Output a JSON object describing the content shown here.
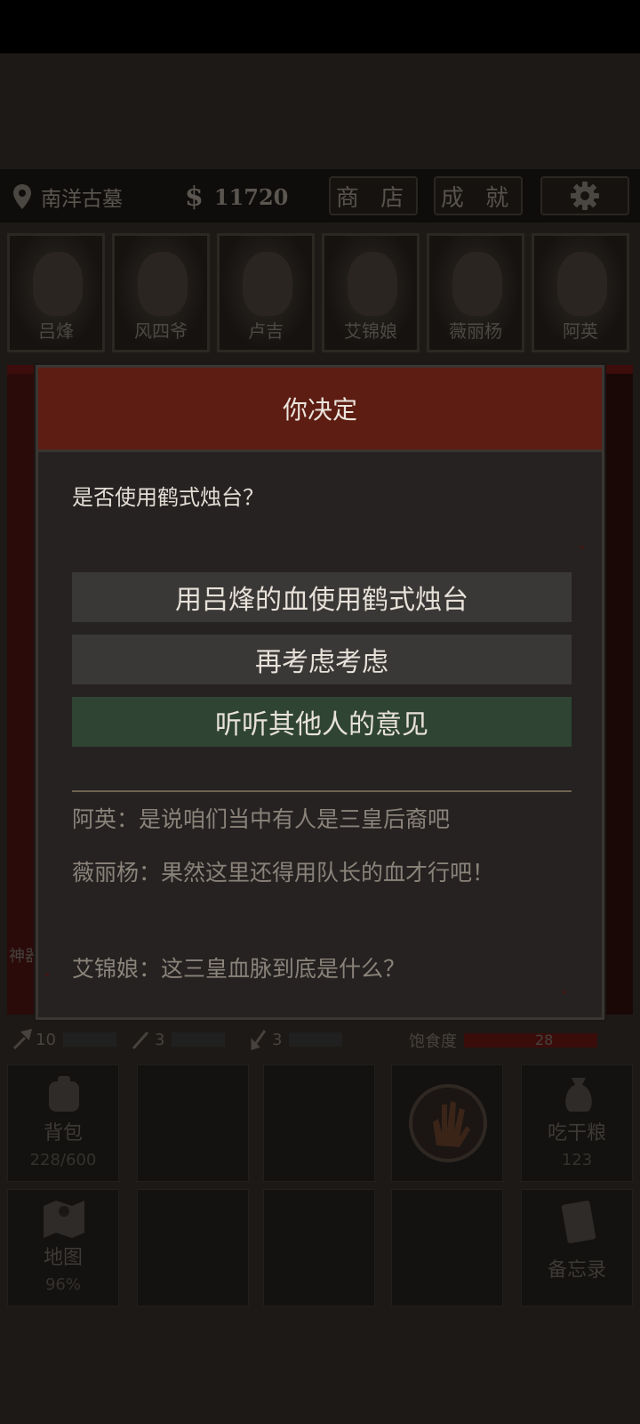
{
  "hud": {
    "location": "南洋古墓",
    "money_symbol": "$",
    "money": "11720",
    "shop_label": "商 店",
    "achievements_label": "成 就"
  },
  "characters": [
    {
      "name": "吕烽"
    },
    {
      "name": "风四爷"
    },
    {
      "name": "卢吉"
    },
    {
      "name": "艾锦娘"
    },
    {
      "name": "薇丽杨"
    },
    {
      "name": "阿英"
    }
  ],
  "side_label": "神器",
  "stats": {
    "stat1": "10",
    "stat2": "3",
    "stat3": "3",
    "satiety_label": "饱食度",
    "satiety_value": "28"
  },
  "actions": {
    "backpack_label": "背包",
    "backpack_count": "228/600",
    "eat_label": "吃干粮",
    "eat_count": "123",
    "map_label": "地图",
    "map_percent": "96%",
    "memo_label": "备忘录"
  },
  "dialog": {
    "title": "你决定",
    "question": "是否使用鹤式烛台？",
    "choices": [
      {
        "label": "用吕烽的血使用鹤式烛台"
      },
      {
        "label": "再考虑考虑"
      },
      {
        "label": "听听其他人的意见"
      }
    ],
    "lines": [
      {
        "speaker": "阿英：",
        "text": "是说咱们当中有人是三皇后裔吧"
      },
      {
        "speaker": "薇丽杨：",
        "text": "果然这里还得用队长的血才行吧！"
      },
      {
        "speaker": "艾锦娘：",
        "text": "这三皇血脉到底是什么？"
      }
    ]
  },
  "colors": {
    "dialog_header": "#5d1d13",
    "choice_grey": "#3a3836",
    "choice_green": "#2f4432"
  }
}
